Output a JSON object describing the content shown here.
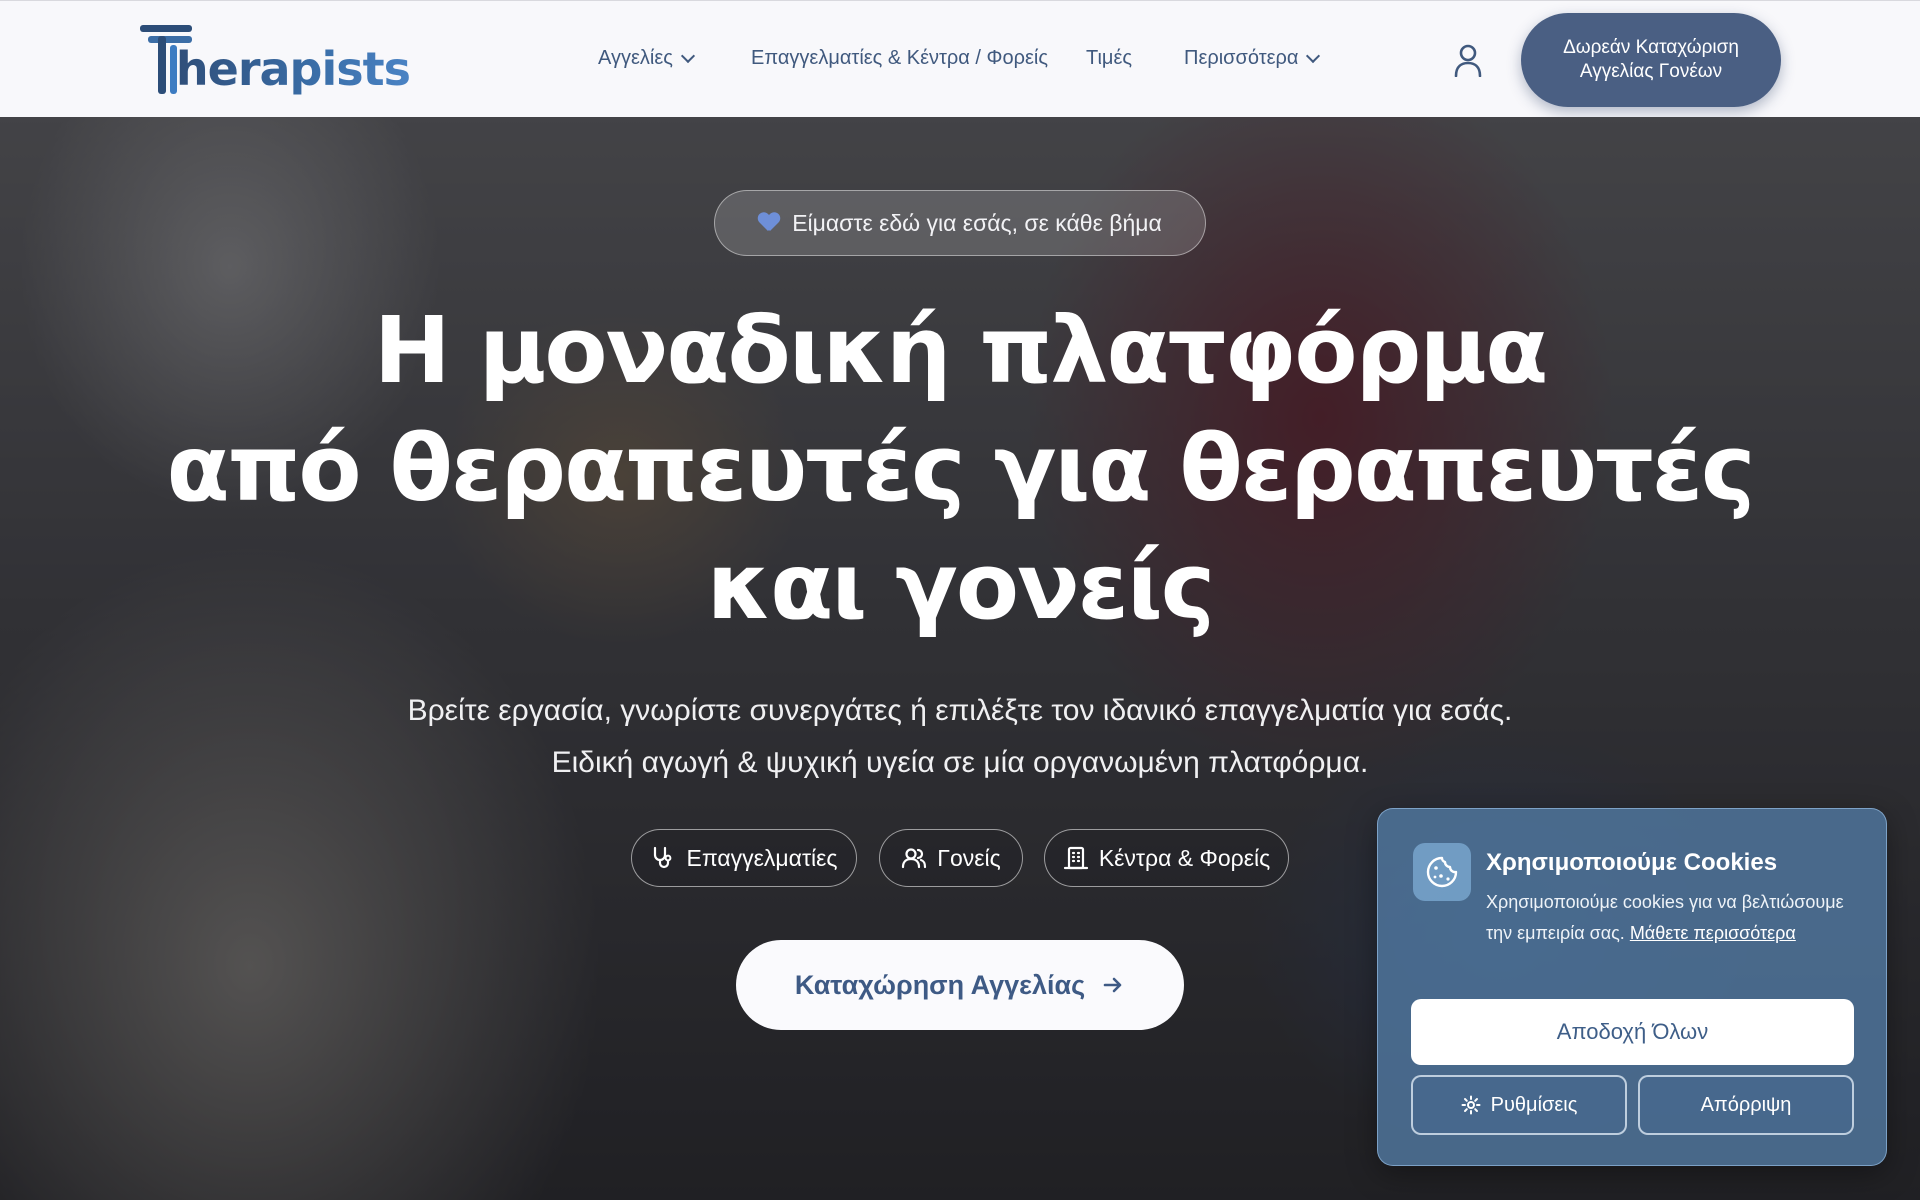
{
  "header": {
    "logo_text": "herapists",
    "nav": [
      {
        "label": "Αγγελίες",
        "has_dropdown": true
      },
      {
        "label": "Επαγγελματίες & Κέντρα / Φορείς",
        "has_dropdown": false
      },
      {
        "label": "Τιμές",
        "has_dropdown": false
      },
      {
        "label": "Περισσότερα",
        "has_dropdown": true
      }
    ],
    "cta_line1": "Δωρεάν Καταχώριση",
    "cta_line2": "Αγγελίας Γονέων"
  },
  "hero": {
    "badge": "Είμαστε εδώ για εσάς, σε κάθε βήμα",
    "headline_line1": "Η μοναδική πλατφόρμα",
    "headline_line2": "από θεραπευτές για θεραπευτές",
    "headline_line3": "και γονείς",
    "sub_line1": "Βρείτε εργασία, γνωρίστε συνεργάτες ή επιλέξτε τον ιδανικό επαγγελματία για εσάς.",
    "sub_line2": "Ειδική αγωγή & ψυχική υγεία σε μία οργανωμένη πλατφόρμα.",
    "pills": [
      {
        "label": "Επαγγελματίες",
        "icon": "stethoscope-icon"
      },
      {
        "label": "Γονείς",
        "icon": "users-icon"
      },
      {
        "label": "Κέντρα & Φορείς",
        "icon": "building-icon"
      }
    ],
    "cta": "Καταχώρηση Αγγελίας"
  },
  "cookie": {
    "title": "Χρησιμοποιούμε Cookies",
    "text": "Χρησιμοποιούμε cookies για να βελτιώσουμε την εμπειρία σας.",
    "link": "Μάθετε περισσότερα",
    "accept": "Αποδοχή Όλων",
    "settings": "Ρυθμίσεις",
    "reject": "Απόρριψη"
  },
  "colors": {
    "brand": "#3b5b86",
    "header_cta": "#4a5f83",
    "cookie_panel": "#5078a0"
  }
}
